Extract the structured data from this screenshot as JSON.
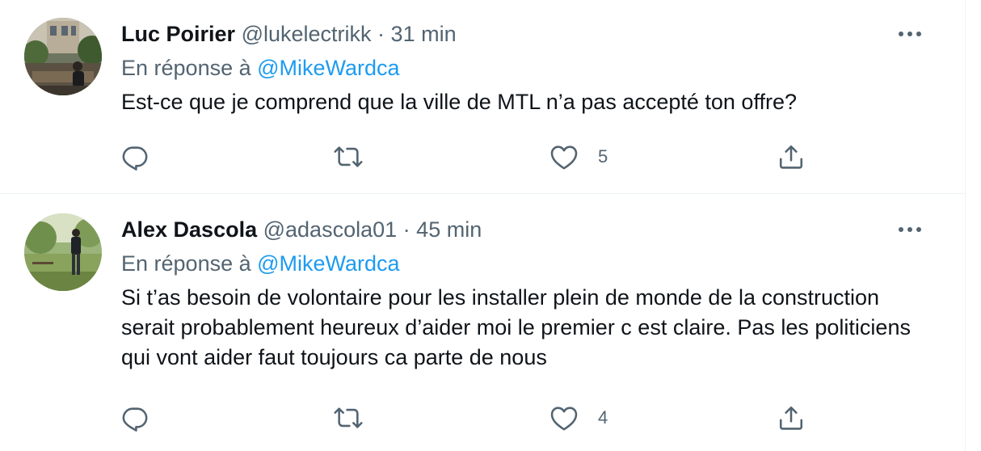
{
  "tweets": [
    {
      "name": "Luc Poirier",
      "handle": "@lukelectrikk",
      "separator": "·",
      "time": "31 min",
      "reply_prefix": "En réponse à",
      "reply_to": "@MikeWardca",
      "text": "Est-ce que je comprend que la ville de MTL n’a pas accepté ton offre?",
      "like_count": "5"
    },
    {
      "name": "Alex Dascola",
      "handle": "@adascola01",
      "separator": "·",
      "time": "45 min",
      "reply_prefix": "En réponse à",
      "reply_to": "@MikeWardca",
      "text": "Si t’as besoin de volontaire pour les installer plein de monde de la construction serait probablement heureux d’aider moi le premier c est claire. Pas les politiciens qui vont aider faut toujours ca parte de nous",
      "like_count": "4"
    }
  ],
  "icons": {
    "reply": "reply-icon",
    "retweet": "retweet-icon",
    "like": "heart-icon",
    "share": "share-icon",
    "more": "more-icon"
  },
  "colors": {
    "mention": "#1d9bf0",
    "secondary_text": "#536471",
    "primary_text": "#0f1419",
    "divider": "#eff3f4"
  }
}
